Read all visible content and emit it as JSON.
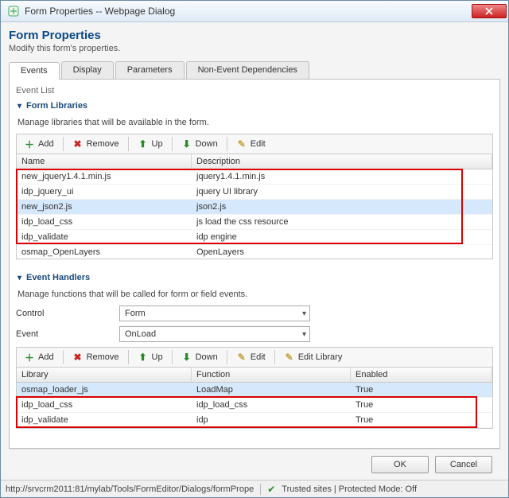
{
  "window": {
    "title": "Form Properties -- Webpage Dialog"
  },
  "page": {
    "title": "Form Properties",
    "subtitle": "Modify this form's properties."
  },
  "tabs": [
    {
      "label": "Events",
      "active": true
    },
    {
      "label": "Display",
      "active": false
    },
    {
      "label": "Parameters",
      "active": false
    },
    {
      "label": "Non-Event Dependencies",
      "active": false
    }
  ],
  "eventListLabel": "Event List",
  "sections": {
    "libraries": {
      "title": "Form Libraries",
      "desc": "Manage libraries that will be available in the form."
    },
    "handlers": {
      "title": "Event Handlers",
      "desc": "Manage functions that will be called for form or field events."
    }
  },
  "toolbar": {
    "add": "Add",
    "remove": "Remove",
    "up": "Up",
    "down": "Down",
    "edit": "Edit",
    "editLibrary": "Edit Library"
  },
  "libGrid": {
    "cols": [
      "Name",
      "Description"
    ],
    "rows": [
      {
        "name": "new_jquery1.4.1.min.js",
        "desc": "jquery1.4.1.min.js",
        "sel": false
      },
      {
        "name": "idp_jquery_ui",
        "desc": "jquery UI library",
        "sel": false
      },
      {
        "name": "new_json2.js",
        "desc": "json2.js",
        "sel": true
      },
      {
        "name": "idp_load_css",
        "desc": "js load the css resource",
        "sel": false
      },
      {
        "name": "idp_validate",
        "desc": "idp engine",
        "sel": false
      },
      {
        "name": "osmap_OpenLayers",
        "desc": "OpenLayers",
        "sel": false
      }
    ]
  },
  "controls": {
    "controlLabel": "Control",
    "controlValue": "Form",
    "eventLabel": "Event",
    "eventValue": "OnLoad"
  },
  "handlerGrid": {
    "cols": [
      "Library",
      "Function",
      "Enabled"
    ],
    "rows": [
      {
        "lib": "osmap_loader_js",
        "fn": "LoadMap",
        "en": "True",
        "sel": true
      },
      {
        "lib": "idp_load_css",
        "fn": "idp_load_css",
        "en": "True",
        "sel": false
      },
      {
        "lib": "idp_validate",
        "fn": "idp",
        "en": "True",
        "sel": false
      }
    ]
  },
  "footer": {
    "ok": "OK",
    "cancel": "Cancel"
  },
  "status": {
    "url": "http://srvcrm2011:81/mylab/Tools/FormEditor/Dialogs/formPrope",
    "zone": "Trusted sites | Protected Mode: Off"
  }
}
